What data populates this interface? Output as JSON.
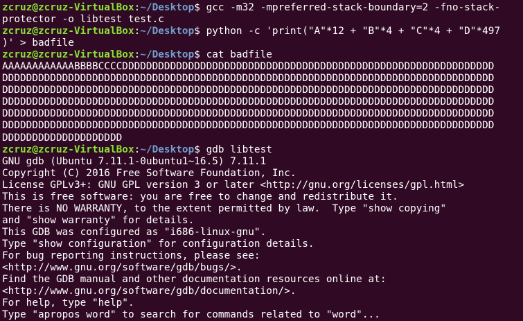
{
  "terminal": {
    "prompt": {
      "user_host": "zcruz@zcruz-VirtualBox",
      "separator": ":",
      "path": "~/Desktop",
      "symbol": "$ "
    },
    "blocks": [
      {
        "type": "command",
        "command_lines": [
          "gcc -m32 -mpreferred-stack-boundary=2 -fno-stack-",
          "protector -o libtest test.c"
        ]
      },
      {
        "type": "command",
        "command_lines": [
          "python -c 'print(\"A\"*12 + \"B\"*4 + \"C\"*4 + \"D\"*497",
          ")' > badfile"
        ]
      },
      {
        "type": "command",
        "command_lines": [
          "cat badfile"
        ]
      },
      {
        "type": "output",
        "lines": [
          "AAAAAAAAAAAABBBBCCCCDDDDDDDDDDDDDDDDDDDDDDDDDDDDDDDDDDDDDDDDDDDDDDDDDDDDDDDDDDDDDD",
          "DDDDDDDDDDDDDDDDDDDDDDDDDDDDDDDDDDDDDDDDDDDDDDDDDDDDDDDDDDDDDDDDDDDDDDDDDDDDDDDDDD",
          "DDDDDDDDDDDDDDDDDDDDDDDDDDDDDDDDDDDDDDDDDDDDDDDDDDDDDDDDDDDDDDDDDDDDDDDDDDDDDDDDDD",
          "DDDDDDDDDDDDDDDDDDDDDDDDDDDDDDDDDDDDDDDDDDDDDDDDDDDDDDDDDDDDDDDDDDDDDDDDDDDDDDDDDD",
          "DDDDDDDDDDDDDDDDDDDDDDDDDDDDDDDDDDDDDDDDDDDDDDDDDDDDDDDDDDDDDDDDDDDDDDDDDDDDDDDDDD",
          "DDDDDDDDDDDDDDDDDDDDDDDDDDDDDDDDDDDDDDDDDDDDDDDDDDDDDDDDDDDDDDDDDDDDDDDDDDDDDDDDDD",
          "DDDDDDDDDDDDDDDDDDDD"
        ]
      },
      {
        "type": "command",
        "command_lines": [
          "gdb libtest"
        ]
      },
      {
        "type": "output",
        "lines": [
          "GNU gdb (Ubuntu 7.11.1-0ubuntu1~16.5) 7.11.1",
          "Copyright (C) 2016 Free Software Foundation, Inc.",
          "License GPLv3+: GNU GPL version 3 or later <http://gnu.org/licenses/gpl.html>",
          "This is free software: you are free to change and redistribute it.",
          "There is NO WARRANTY, to the extent permitted by law.  Type \"show copying\"",
          "and \"show warranty\" for details.",
          "This GDB was configured as \"i686-linux-gnu\".",
          "Type \"show configuration\" for configuration details.",
          "For bug reporting instructions, please see:",
          "<http://www.gnu.org/software/gdb/bugs/>.",
          "Find the GDB manual and other documentation resources online at:",
          "<http://www.gnu.org/software/gdb/documentation/>.",
          "For help, type \"help\".",
          "Type \"apropos word\" to search for commands related to \"word\"..."
        ]
      }
    ]
  },
  "colors": {
    "background": "#300a24",
    "text": "#ffffff",
    "prompt_user": "#8ae234",
    "prompt_path": "#729fcf"
  }
}
